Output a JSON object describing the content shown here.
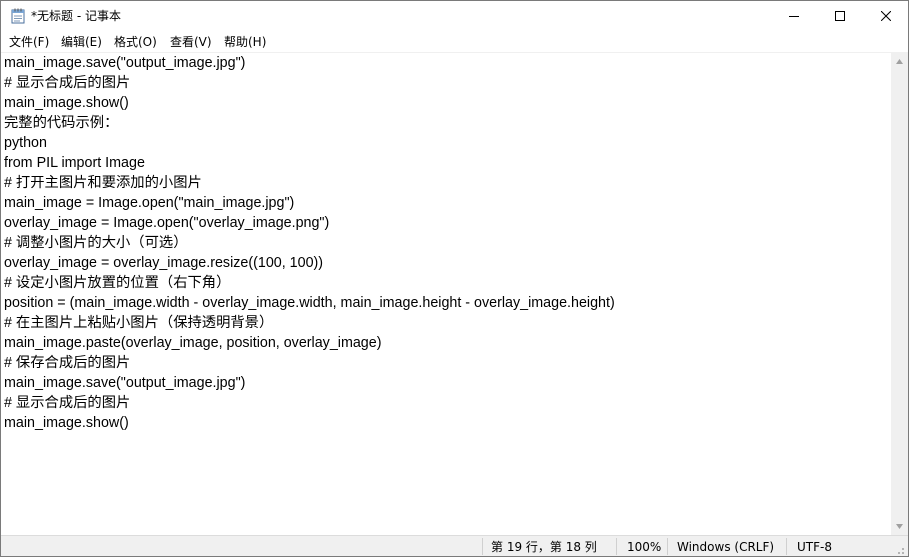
{
  "window": {
    "title": "*无标题 - 记事本",
    "icon": "notepad-icon"
  },
  "caption_buttons": {
    "minimize_icon": "minimize-icon",
    "maximize_icon": "maximize-icon",
    "close_icon": "close-icon"
  },
  "menu": {
    "items": [
      {
        "label": "文件(F)"
      },
      {
        "label": "编辑(E)"
      },
      {
        "label": "格式(O)"
      },
      {
        "label": "查看(V)"
      },
      {
        "label": "帮助(H)"
      }
    ]
  },
  "editor": {
    "lines": [
      "main_image.save(\"output_image.jpg\")",
      "# 显示合成后的图片",
      "main_image.show()",
      "完整的代码示例：",
      "python",
      "from PIL import Image",
      "# 打开主图片和要添加的小图片",
      "main_image = Image.open(\"main_image.jpg\")",
      "overlay_image = Image.open(\"overlay_image.png\")",
      "# 调整小图片的大小（可选）",
      "overlay_image = overlay_image.resize((100, 100))",
      "# 设定小图片放置的位置（右下角）",
      "position = (main_image.width - overlay_image.width, main_image.height - overlay_image.height)",
      "# 在主图片上粘贴小图片（保持透明背景）",
      "main_image.paste(overlay_image, position, overlay_image)",
      "# 保存合成后的图片",
      "main_image.save(\"output_image.jpg\")",
      "# 显示合成后的图片",
      "main_image.show()"
    ]
  },
  "status": {
    "position": "第 19 行，第 18 列",
    "zoom": "100%",
    "line_ending": "Windows (CRLF)",
    "encoding": "UTF-8"
  }
}
